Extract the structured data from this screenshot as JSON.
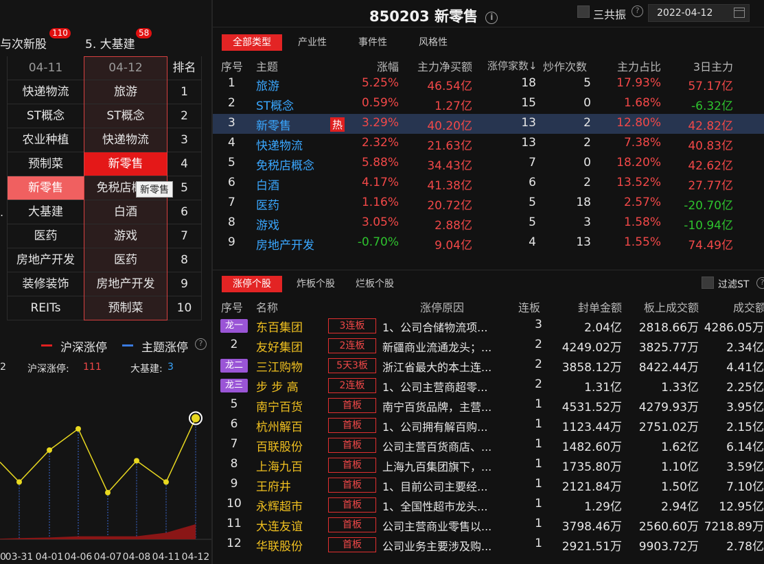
{
  "left": {
    "tabs": [
      {
        "label": "与次新股",
        "badge": "110"
      },
      {
        "label": "5. 大基建",
        "badge": "58"
      }
    ],
    "rank_header": {
      "col1": "04-11",
      "col2": "04-12",
      "col3": "排名"
    },
    "rank_rows": [
      {
        "col1": "快递物流",
        "col2": "旅游",
        "rank": "1"
      },
      {
        "col1": "ST概念",
        "col2": "ST概念",
        "rank": "2"
      },
      {
        "col1": "农业种植",
        "col2": "快递物流",
        "rank": "3"
      },
      {
        "col1": "预制菜",
        "col2": "新零售",
        "rank": "4"
      },
      {
        "col1": "新零售",
        "col2": "免税店概念",
        "rank": "5"
      },
      {
        "col1": "大基建",
        "col2": "白酒",
        "rank": "6"
      },
      {
        "col1": "医药",
        "col2": "游戏",
        "rank": "7"
      },
      {
        "col1": "房地产开发",
        "col2": "医药",
        "rank": "8"
      },
      {
        "col1": "装修装饰",
        "col2": "房地产开发",
        "rank": "9"
      },
      {
        "col1": "REITs",
        "col2": "预制菜",
        "rank": "10"
      }
    ],
    "tooltip": "新零售",
    "left_edge_dot": ".",
    "legend": {
      "item1": "沪深涨停",
      "item2": "主题涨停",
      "color1": "#e02020",
      "color2": "#3a7be0"
    },
    "info": {
      "prefix": "2",
      "label1": "沪深涨停:",
      "value1": "111",
      "label2": "大基建:",
      "value2": "3"
    }
  },
  "chart_data": {
    "type": "line",
    "categories": [
      "03-31",
      "04-01",
      "04-06",
      "04-07",
      "04-08",
      "04-11",
      "04-12"
    ],
    "partial_left_tick": "0",
    "series": [
      {
        "name": "主题涨停",
        "color": "#e8d820",
        "values": [
          5,
          8,
          10,
          4,
          7,
          5,
          11
        ]
      },
      {
        "name": "沪深涨停",
        "color": "#8a1616",
        "values": [
          2,
          3,
          5,
          5,
          5,
          11,
          25
        ]
      }
    ]
  },
  "header": {
    "title": "850203 新零售",
    "sangongzhen": "三共振",
    "date": "2022-04-12"
  },
  "theme_tabs": [
    "全部类型",
    "产业性",
    "事件性",
    "风格性"
  ],
  "theme_columns": {
    "seq": "序号",
    "theme": "主题",
    "change": "涨幅",
    "net": "主力净买额",
    "limit_up": "涨停家数↓",
    "hype": "炒作次数",
    "ratio": "主力占比",
    "three_day": "3日主力"
  },
  "themes": [
    {
      "seq": "1",
      "name": "旅游",
      "hot": "",
      "change": "5.25%",
      "net": "46.54亿",
      "limit_up": "18",
      "hype": "5",
      "ratio": "17.93%",
      "three_day": "57.17亿",
      "change_dir": "up",
      "net_dir": "up",
      "three_dir": "up"
    },
    {
      "seq": "2",
      "name": "ST概念",
      "hot": "",
      "change": "0.59%",
      "net": "1.27亿",
      "limit_up": "15",
      "hype": "0",
      "ratio": "1.68%",
      "three_day": "-6.32亿",
      "change_dir": "up",
      "net_dir": "up",
      "three_dir": "down"
    },
    {
      "seq": "3",
      "name": "新零售",
      "hot": "热",
      "change": "3.29%",
      "net": "40.20亿",
      "limit_up": "13",
      "hype": "2",
      "ratio": "12.80%",
      "three_day": "42.82亿",
      "change_dir": "up",
      "net_dir": "up",
      "three_dir": "up"
    },
    {
      "seq": "4",
      "name": "快递物流",
      "hot": "",
      "change": "2.32%",
      "net": "21.63亿",
      "limit_up": "13",
      "hype": "2",
      "ratio": "7.38%",
      "three_day": "40.83亿",
      "change_dir": "up",
      "net_dir": "up",
      "three_dir": "up"
    },
    {
      "seq": "5",
      "name": "免税店概念",
      "hot": "",
      "change": "5.88%",
      "net": "34.43亿",
      "limit_up": "7",
      "hype": "0",
      "ratio": "18.20%",
      "three_day": "42.62亿",
      "change_dir": "up",
      "net_dir": "up",
      "three_dir": "up"
    },
    {
      "seq": "6",
      "name": "白酒",
      "hot": "",
      "change": "4.17%",
      "net": "41.38亿",
      "limit_up": "6",
      "hype": "2",
      "ratio": "13.52%",
      "three_day": "27.77亿",
      "change_dir": "up",
      "net_dir": "up",
      "three_dir": "up"
    },
    {
      "seq": "7",
      "name": "医药",
      "hot": "",
      "change": "1.16%",
      "net": "20.72亿",
      "limit_up": "5",
      "hype": "18",
      "ratio": "2.57%",
      "three_day": "-20.70亿",
      "change_dir": "up",
      "net_dir": "up",
      "three_dir": "down"
    },
    {
      "seq": "8",
      "name": "游戏",
      "hot": "",
      "change": "3.05%",
      "net": "2.88亿",
      "limit_up": "5",
      "hype": "3",
      "ratio": "1.58%",
      "three_day": "-10.94亿",
      "change_dir": "up",
      "net_dir": "up",
      "three_dir": "down"
    },
    {
      "seq": "9",
      "name": "房地产开发",
      "hot": "",
      "change": "-0.70%",
      "net": "9.04亿",
      "limit_up": "4",
      "hype": "13",
      "ratio": "1.55%",
      "three_day": "74.49亿",
      "change_dir": "down",
      "net_dir": "up",
      "three_dir": "up"
    }
  ],
  "stock_tabs": [
    "涨停个股",
    "炸板个股",
    "烂板个股"
  ],
  "filter_st": "过滤ST",
  "stock_columns": {
    "seq": "序号",
    "name": "名称",
    "reason": "涨停原因",
    "boards": "连板",
    "seal": "封单金额",
    "board_vol": "板上成交额",
    "vol": "成交额"
  },
  "stocks": [
    {
      "seq": "龙一",
      "seq_is_badge": true,
      "name": "东百集团",
      "tag": "3连板",
      "reason": "1、公司合储物流项...",
      "boards": "3",
      "seal": "2.04亿",
      "board_vol": "2818.66万",
      "vol": "4286.05万"
    },
    {
      "seq": "2",
      "seq_is_badge": false,
      "name": "友好集团",
      "tag": "2连板",
      "reason": "新疆商业流通龙头；...",
      "boards": "2",
      "seal": "4249.02万",
      "board_vol": "3825.77万",
      "vol": "2.34亿"
    },
    {
      "seq": "龙二",
      "seq_is_badge": true,
      "name": "三江购物",
      "tag": "5天3板",
      "reason": "浙江省最大的本土连...",
      "boards": "2",
      "seal": "3858.12万",
      "board_vol": "8422.44万",
      "vol": "4.41亿"
    },
    {
      "seq": "龙三",
      "seq_is_badge": true,
      "name": "步 步 高",
      "tag": "2连板",
      "reason": "1、公司主营商超零...",
      "boards": "2",
      "seal": "1.31亿",
      "board_vol": "1.33亿",
      "vol": "2.25亿"
    },
    {
      "seq": "5",
      "seq_is_badge": false,
      "name": "南宁百货",
      "tag": "首板",
      "reason": "南宁百货品牌，主营...",
      "boards": "1",
      "seal": "4531.52万",
      "board_vol": "4279.93万",
      "vol": "3.95亿"
    },
    {
      "seq": "6",
      "seq_is_badge": false,
      "name": "杭州解百",
      "tag": "首板",
      "reason": "1、公司拥有解百购...",
      "boards": "1",
      "seal": "1123.44万",
      "board_vol": "2751.02万",
      "vol": "2.15亿"
    },
    {
      "seq": "7",
      "seq_is_badge": false,
      "name": "百联股份",
      "tag": "首板",
      "reason": "公司主营百货商店、...",
      "boards": "1",
      "seal": "1482.60万",
      "board_vol": "1.62亿",
      "vol": "6.14亿"
    },
    {
      "seq": "8",
      "seq_is_badge": false,
      "name": "上海九百",
      "tag": "首板",
      "reason": "上海九百集团旗下，...",
      "boards": "1",
      "seal": "1735.80万",
      "board_vol": "1.10亿",
      "vol": "3.59亿"
    },
    {
      "seq": "9",
      "seq_is_badge": false,
      "name": "王府井",
      "tag": "首板",
      "reason": "1、目前公司主要经...",
      "boards": "1",
      "seal": "2121.84万",
      "board_vol": "1.50亿",
      "vol": "7.10亿"
    },
    {
      "seq": "10",
      "seq_is_badge": false,
      "name": "永辉超市",
      "tag": "首板",
      "reason": "1、全国性超市龙头...",
      "boards": "1",
      "seal": "1.29亿",
      "board_vol": "2.94亿",
      "vol": "12.95亿"
    },
    {
      "seq": "11",
      "seq_is_badge": false,
      "name": "大连友谊",
      "tag": "首板",
      "reason": "公司主营商业零售以...",
      "boards": "1",
      "seal": "3798.46万",
      "board_vol": "2560.60万",
      "vol": "7218.89万"
    },
    {
      "seq": "12",
      "seq_is_badge": false,
      "name": "华联股份",
      "tag": "首板",
      "reason": "公司业务主要涉及购...",
      "boards": "1",
      "seal": "2921.51万",
      "board_vol": "9903.72万",
      "vol": "2.78亿"
    }
  ]
}
